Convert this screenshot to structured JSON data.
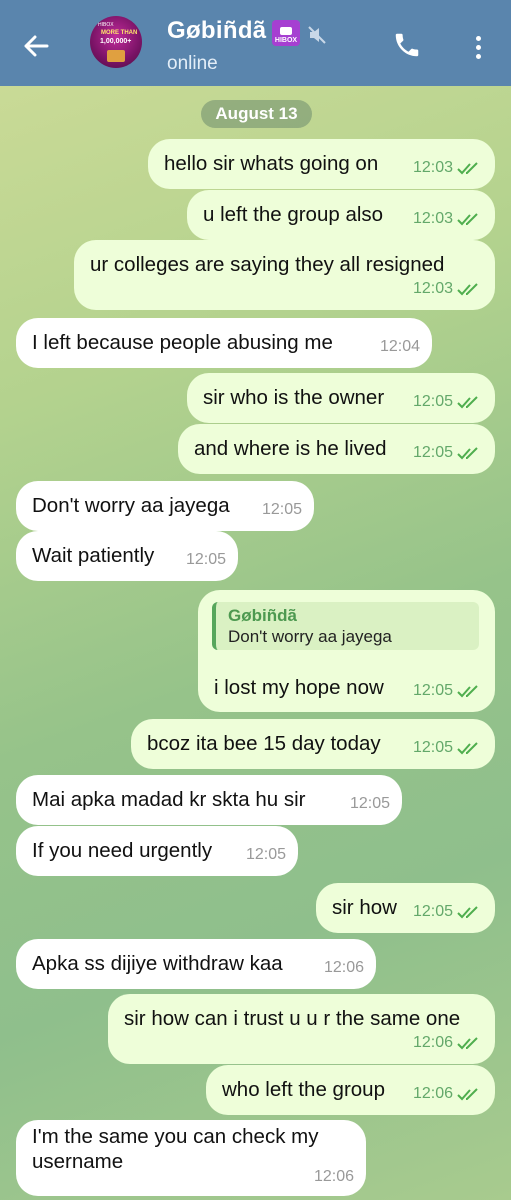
{
  "header": {
    "title": "Gøbiñdã",
    "badge": "HIBOX",
    "status": "online",
    "avatar": {
      "line1": "HIBOX",
      "line2": "MORE THAN",
      "line3": "1,00,000+"
    }
  },
  "date_separator": "August 13",
  "messages": [
    {
      "dir": "out",
      "text": "hello sir whats going on",
      "time": "12:03"
    },
    {
      "dir": "out",
      "text": "u left the group also",
      "time": "12:03"
    },
    {
      "dir": "out",
      "text": "ur colleges are saying they all resigned",
      "time": "12:03"
    },
    {
      "dir": "in",
      "text": "I left because people abusing me",
      "time": "12:04"
    },
    {
      "dir": "out",
      "text": "sir who is the owner",
      "time": "12:05"
    },
    {
      "dir": "out",
      "text": "and where is he lived",
      "time": "12:05"
    },
    {
      "dir": "in",
      "text": "Don't worry aa jayega",
      "time": "12:05"
    },
    {
      "dir": "in",
      "text": "Wait patiently",
      "time": "12:05"
    },
    {
      "dir": "out",
      "text": "i lost my hope now",
      "time": "12:05",
      "reply": {
        "name": "Gøbiñdã",
        "text": "Don't worry aa jayega"
      }
    },
    {
      "dir": "out",
      "text": "bcoz ita bee 15 day today",
      "time": "12:05"
    },
    {
      "dir": "in",
      "text": "Mai apka madad kr skta hu sir",
      "time": "12:05"
    },
    {
      "dir": "in",
      "text": "If you need urgently",
      "time": "12:05"
    },
    {
      "dir": "out",
      "text": "sir how",
      "time": "12:05"
    },
    {
      "dir": "in",
      "text": "Apka ss dijiye withdraw kaa",
      "time": "12:06"
    },
    {
      "dir": "out",
      "text": "sir how can i trust u u r the same one",
      "time": "12:06"
    },
    {
      "dir": "out",
      "text": "who left the group",
      "time": "12:06"
    },
    {
      "dir": "in",
      "text": "I'm the same you can check my username",
      "time": "12:06"
    }
  ]
}
